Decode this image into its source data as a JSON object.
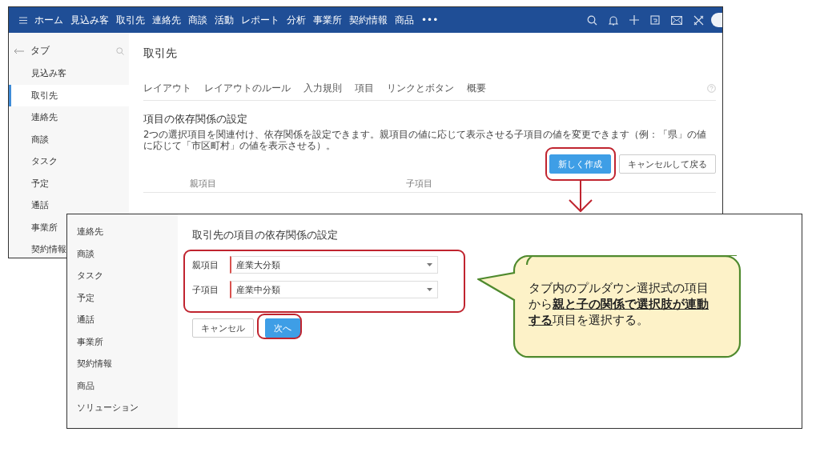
{
  "main_screen": {
    "nav": {
      "items": [
        "ホーム",
        "見込み客",
        "取引先",
        "連絡先",
        "商談",
        "活動",
        "レポート",
        "分析",
        "事業所",
        "契約情報",
        "商品"
      ],
      "more": "•••"
    },
    "sidebar": {
      "title": "タブ",
      "items": [
        {
          "label": "見込み客",
          "selected": false
        },
        {
          "label": "取引先",
          "selected": true
        },
        {
          "label": "連絡先",
          "selected": false
        },
        {
          "label": "商談",
          "selected": false
        },
        {
          "label": "タスク",
          "selected": false
        },
        {
          "label": "予定",
          "selected": false
        },
        {
          "label": "通話",
          "selected": false
        },
        {
          "label": "事業所",
          "selected": false
        },
        {
          "label": "契約情報",
          "selected": false
        }
      ]
    },
    "page_title": "取引先",
    "tabs": [
      "レイアウト",
      "レイアウトのルール",
      "入力規則",
      "項目",
      "リンクとボタン",
      "概要"
    ],
    "section_title": "項目の依存関係の設定",
    "description": "2つの選択項目を関連付け、依存関係を設定できます。親項目の値に応じて表示させる子項目の値を変更できます（例：「県」の値に応じて「市区町村」の値を表示させる）。",
    "buttons": [
      {
        "label": "新しく作成",
        "kind": "primary"
      },
      {
        "label": "キャンセルして戻る",
        "kind": "secondary"
      }
    ],
    "table": {
      "columns": [
        "親項目",
        "子項目"
      ]
    }
  },
  "dialog_screen": {
    "sidebar": {
      "items": [
        {
          "label": "連絡先"
        },
        {
          "label": "商談"
        },
        {
          "label": "タスク"
        },
        {
          "label": "予定"
        },
        {
          "label": "通話"
        },
        {
          "label": "事業所"
        },
        {
          "label": "契約情報"
        },
        {
          "label": "商品"
        },
        {
          "label": "ソリューション"
        }
      ]
    },
    "title": "取引先の項目の依存関係の設定",
    "fields": [
      {
        "label": "親項目",
        "value": "産業大分類"
      },
      {
        "label": "子項目",
        "value": "産業中分類"
      }
    ],
    "buttons": [
      {
        "label": "キャンセル",
        "kind": "secondary"
      },
      {
        "label": "次へ",
        "kind": "primary"
      }
    ]
  },
  "callout": {
    "text": "タブ内のプルダウン選択式の項目から**親と子の関係で選択肢が連動する**項目を選択する。"
  }
}
